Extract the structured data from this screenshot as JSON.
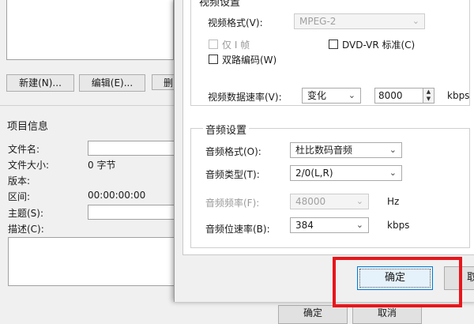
{
  "background_window": {
    "buttons": {
      "new": "新建(N)...",
      "edit": "编辑(E)...",
      "delete_partial": "删"
    },
    "project_info": {
      "title": "项目信息",
      "filename_label": "文件名:",
      "filesize_label": "文件大小:",
      "filesize_value": "0 字节",
      "version_label": "版本:",
      "interval_label": "区间:",
      "interval_value": "00:00:00:00",
      "subject_label": "主题(S):",
      "description_label": "描述(C):"
    },
    "bottom_buttons": {
      "ok": "确定",
      "cancel": "取消"
    }
  },
  "dialog": {
    "video_settings": {
      "title": "视频设置",
      "format_label": "视频格式(V):",
      "format_value": "MPEG-2",
      "iframe_only_label": "仅 I 帧",
      "dvdvr_label": "DVD-VR 标准(C)",
      "dual_pass_label": "双路编码(W)",
      "bitrate_label": "视频数据速率(V):",
      "bitrate_mode": "变化",
      "bitrate_value": "8000",
      "bitrate_unit": "kbps"
    },
    "audio_settings": {
      "title": "音频设置",
      "format_label": "音频格式(O):",
      "format_value": "杜比数码音频",
      "type_label": "音频类型(T):",
      "type_value": "2/0(L,R)",
      "freq_label": "音频频率(F):",
      "freq_value": "48000",
      "freq_unit": "Hz",
      "bitrate_label": "音频位速率(B):",
      "bitrate_value": "384",
      "bitrate_unit": "kbps"
    },
    "ok_label": "确定",
    "cancel_partial": "取"
  },
  "colors": {
    "highlight": "#e8151b",
    "focus_border": "#0078d7"
  },
  "icons": {
    "dropdown": "chevron-down-icon",
    "spin": "spin-updown-icon"
  }
}
